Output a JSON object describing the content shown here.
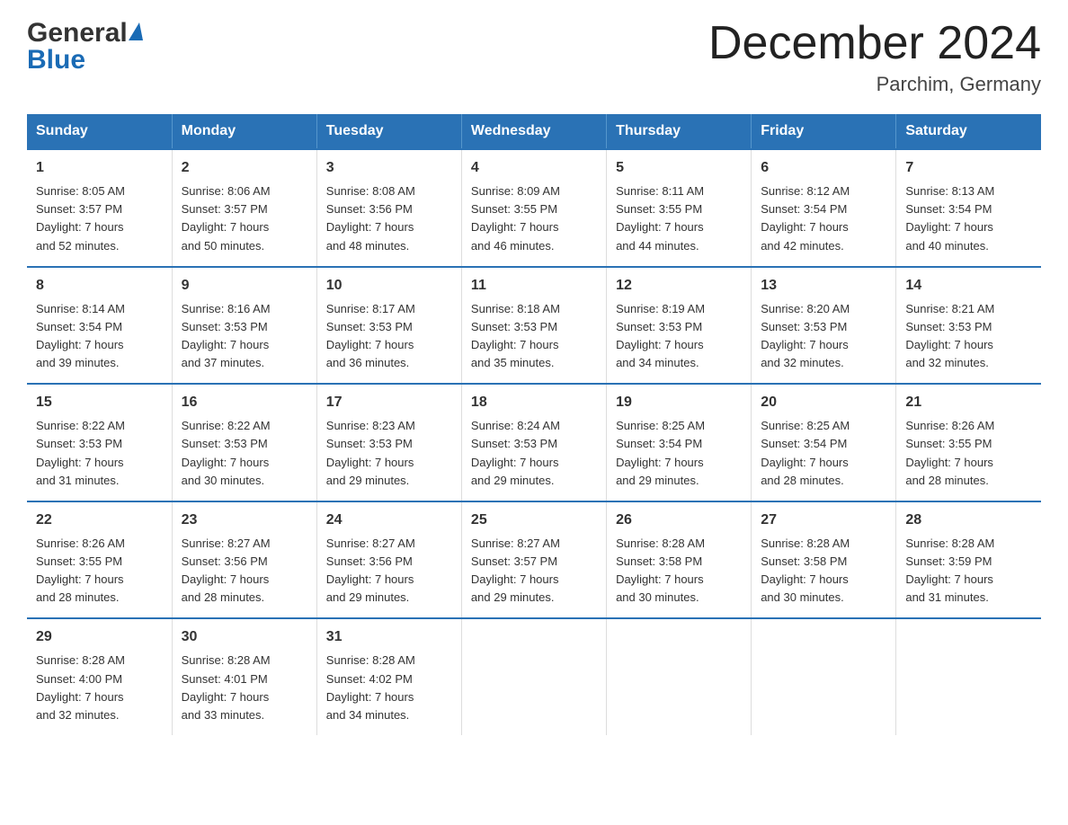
{
  "logo": {
    "line1": "General",
    "triangle": "▶",
    "line2": "Blue"
  },
  "title": "December 2024",
  "subtitle": "Parchim, Germany",
  "columns": [
    "Sunday",
    "Monday",
    "Tuesday",
    "Wednesday",
    "Thursday",
    "Friday",
    "Saturday"
  ],
  "weeks": [
    [
      {
        "day": "1",
        "sunrise": "8:05 AM",
        "sunset": "3:57 PM",
        "daylight": "7 hours and 52 minutes."
      },
      {
        "day": "2",
        "sunrise": "8:06 AM",
        "sunset": "3:57 PM",
        "daylight": "7 hours and 50 minutes."
      },
      {
        "day": "3",
        "sunrise": "8:08 AM",
        "sunset": "3:56 PM",
        "daylight": "7 hours and 48 minutes."
      },
      {
        "day": "4",
        "sunrise": "8:09 AM",
        "sunset": "3:55 PM",
        "daylight": "7 hours and 46 minutes."
      },
      {
        "day": "5",
        "sunrise": "8:11 AM",
        "sunset": "3:55 PM",
        "daylight": "7 hours and 44 minutes."
      },
      {
        "day": "6",
        "sunrise": "8:12 AM",
        "sunset": "3:54 PM",
        "daylight": "7 hours and 42 minutes."
      },
      {
        "day": "7",
        "sunrise": "8:13 AM",
        "sunset": "3:54 PM",
        "daylight": "7 hours and 40 minutes."
      }
    ],
    [
      {
        "day": "8",
        "sunrise": "8:14 AM",
        "sunset": "3:54 PM",
        "daylight": "7 hours and 39 minutes."
      },
      {
        "day": "9",
        "sunrise": "8:16 AM",
        "sunset": "3:53 PM",
        "daylight": "7 hours and 37 minutes."
      },
      {
        "day": "10",
        "sunrise": "8:17 AM",
        "sunset": "3:53 PM",
        "daylight": "7 hours and 36 minutes."
      },
      {
        "day": "11",
        "sunrise": "8:18 AM",
        "sunset": "3:53 PM",
        "daylight": "7 hours and 35 minutes."
      },
      {
        "day": "12",
        "sunrise": "8:19 AM",
        "sunset": "3:53 PM",
        "daylight": "7 hours and 34 minutes."
      },
      {
        "day": "13",
        "sunrise": "8:20 AM",
        "sunset": "3:53 PM",
        "daylight": "7 hours and 32 minutes."
      },
      {
        "day": "14",
        "sunrise": "8:21 AM",
        "sunset": "3:53 PM",
        "daylight": "7 hours and 32 minutes."
      }
    ],
    [
      {
        "day": "15",
        "sunrise": "8:22 AM",
        "sunset": "3:53 PM",
        "daylight": "7 hours and 31 minutes."
      },
      {
        "day": "16",
        "sunrise": "8:22 AM",
        "sunset": "3:53 PM",
        "daylight": "7 hours and 30 minutes."
      },
      {
        "day": "17",
        "sunrise": "8:23 AM",
        "sunset": "3:53 PM",
        "daylight": "7 hours and 29 minutes."
      },
      {
        "day": "18",
        "sunrise": "8:24 AM",
        "sunset": "3:53 PM",
        "daylight": "7 hours and 29 minutes."
      },
      {
        "day": "19",
        "sunrise": "8:25 AM",
        "sunset": "3:54 PM",
        "daylight": "7 hours and 29 minutes."
      },
      {
        "day": "20",
        "sunrise": "8:25 AM",
        "sunset": "3:54 PM",
        "daylight": "7 hours and 28 minutes."
      },
      {
        "day": "21",
        "sunrise": "8:26 AM",
        "sunset": "3:55 PM",
        "daylight": "7 hours and 28 minutes."
      }
    ],
    [
      {
        "day": "22",
        "sunrise": "8:26 AM",
        "sunset": "3:55 PM",
        "daylight": "7 hours and 28 minutes."
      },
      {
        "day": "23",
        "sunrise": "8:27 AM",
        "sunset": "3:56 PM",
        "daylight": "7 hours and 28 minutes."
      },
      {
        "day": "24",
        "sunrise": "8:27 AM",
        "sunset": "3:56 PM",
        "daylight": "7 hours and 29 minutes."
      },
      {
        "day": "25",
        "sunrise": "8:27 AM",
        "sunset": "3:57 PM",
        "daylight": "7 hours and 29 minutes."
      },
      {
        "day": "26",
        "sunrise": "8:28 AM",
        "sunset": "3:58 PM",
        "daylight": "7 hours and 30 minutes."
      },
      {
        "day": "27",
        "sunrise": "8:28 AM",
        "sunset": "3:58 PM",
        "daylight": "7 hours and 30 minutes."
      },
      {
        "day": "28",
        "sunrise": "8:28 AM",
        "sunset": "3:59 PM",
        "daylight": "7 hours and 31 minutes."
      }
    ],
    [
      {
        "day": "29",
        "sunrise": "8:28 AM",
        "sunset": "4:00 PM",
        "daylight": "7 hours and 32 minutes."
      },
      {
        "day": "30",
        "sunrise": "8:28 AM",
        "sunset": "4:01 PM",
        "daylight": "7 hours and 33 minutes."
      },
      {
        "day": "31",
        "sunrise": "8:28 AM",
        "sunset": "4:02 PM",
        "daylight": "7 hours and 34 minutes."
      },
      null,
      null,
      null,
      null
    ]
  ],
  "labels": {
    "sunrise": "Sunrise:",
    "sunset": "Sunset:",
    "daylight": "Daylight:"
  }
}
